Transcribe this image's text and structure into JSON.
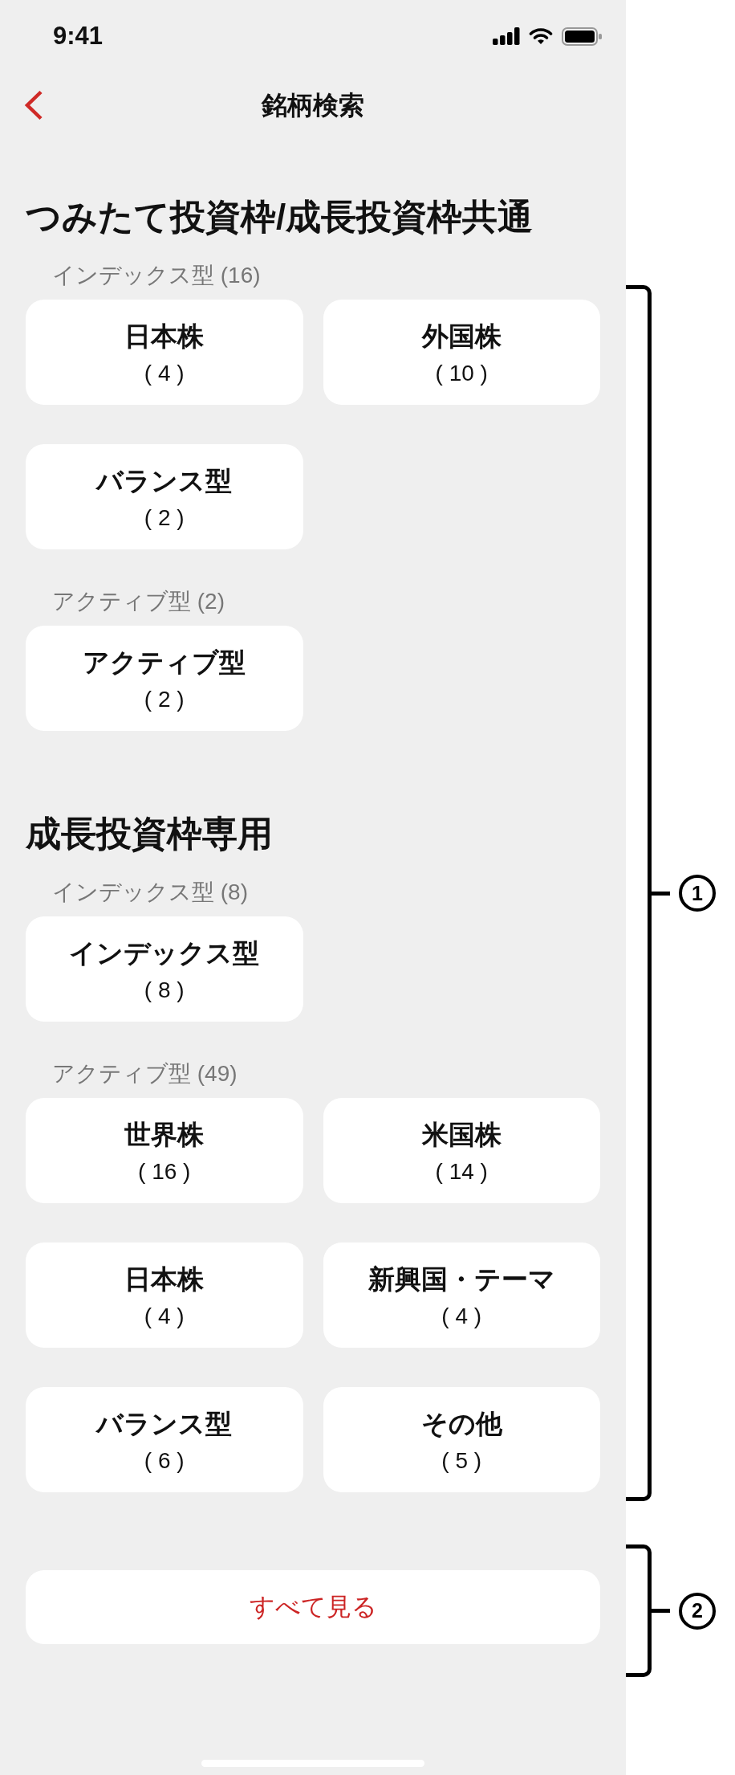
{
  "status_bar": {
    "time": "9:41"
  },
  "header": {
    "title": "銘柄検索"
  },
  "sections": [
    {
      "title": "つみたて投資枠/成長投資枠共通",
      "groups": [
        {
          "label": "インデックス型 (16)",
          "items": [
            {
              "name": "日本株",
              "count": "( 4 )"
            },
            {
              "name": "外国株",
              "count": "( 10 )"
            },
            {
              "name": "バランス型",
              "count": "( 2 )"
            }
          ]
        },
        {
          "label": "アクティブ型 (2)",
          "items": [
            {
              "name": "アクティブ型",
              "count": "( 2 )"
            }
          ]
        }
      ]
    },
    {
      "title": "成長投資枠専用",
      "groups": [
        {
          "label": "インデックス型 (8)",
          "items": [
            {
              "name": "インデックス型",
              "count": "( 8 )"
            }
          ]
        },
        {
          "label": "アクティブ型 (49)",
          "items": [
            {
              "name": "世界株",
              "count": "( 16 )"
            },
            {
              "name": "米国株",
              "count": "( 14 )"
            },
            {
              "name": "日本株",
              "count": "( 4 )"
            },
            {
              "name": "新興国・テーマ",
              "count": "( 4 )"
            },
            {
              "name": "バランス型",
              "count": "( 6 )"
            },
            {
              "name": "その他",
              "count": "( 5 )"
            }
          ]
        }
      ]
    }
  ],
  "view_all_button": {
    "label": "すべて見る"
  },
  "annotations": [
    {
      "label": "1"
    },
    {
      "label": "2"
    }
  ]
}
